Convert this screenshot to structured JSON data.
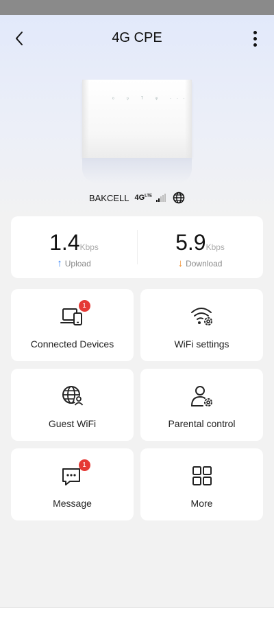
{
  "header": {
    "title": "4G CPE",
    "back_icon": "chevron-left-icon",
    "menu_icon": "more-vertical-icon"
  },
  "device": {
    "image": "4g-cpe-router",
    "carrier": "BAKCELL",
    "network_type": "4G",
    "network_type_suffix": "LTE",
    "signal_icon": "signal-bars-icon",
    "globe_icon": "globe-icon"
  },
  "speed": {
    "upload": {
      "value": "1.4",
      "unit": "Kbps",
      "label": "Upload",
      "icon": "arrow-up-icon",
      "color": "#2d7ff9"
    },
    "download": {
      "value": "5.9",
      "unit": "Kbps",
      "label": "Download",
      "icon": "arrow-down-icon",
      "color": "#f08a24"
    }
  },
  "tiles": [
    {
      "label": "Connected Devices",
      "icon": "devices-icon",
      "badge": "1"
    },
    {
      "label": "WiFi settings",
      "icon": "wifi-settings-icon"
    },
    {
      "label": "Guest WiFi",
      "icon": "guest-globe-icon"
    },
    {
      "label": "Parental control",
      "icon": "user-settings-icon"
    },
    {
      "label": "Message",
      "icon": "message-icon",
      "badge": "1"
    },
    {
      "label": "More",
      "icon": "grid-icon"
    }
  ],
  "colors": {
    "badge": "#e53935",
    "background": "#f2f2f2",
    "card": "#ffffff"
  }
}
